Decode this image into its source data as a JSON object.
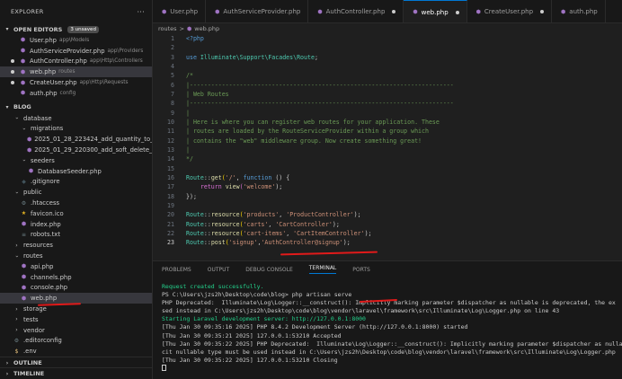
{
  "explorer": {
    "title": "EXPLORER",
    "more": "···",
    "open_editors": {
      "label": "OPEN EDITORS",
      "badge": "3 unsaved",
      "items": [
        {
          "name": "User.php",
          "path": "app\\Models",
          "state": "none"
        },
        {
          "name": "AuthServiceProvider.php",
          "path": "app\\Providers",
          "state": "none"
        },
        {
          "name": "AuthController.php",
          "path": "app\\Http\\Controllers",
          "state": "dot"
        },
        {
          "name": "web.php",
          "path": "routes",
          "state": "dot"
        },
        {
          "name": "CreateUser.php",
          "path": "app\\Http\\Requests",
          "state": "dot"
        },
        {
          "name": "auth.php",
          "path": "config",
          "state": "none"
        }
      ]
    },
    "project": {
      "label": "BLOG",
      "tree": [
        {
          "label": "database",
          "depth": 1,
          "kind": "folder-open"
        },
        {
          "label": "migrations",
          "depth": 2,
          "kind": "folder-open"
        },
        {
          "label": "2025_01_28_223424_add_quantity_to_cart...",
          "depth": 3,
          "kind": "php"
        },
        {
          "label": "2025_01_29_220300_add_soft_delete_to_c...",
          "depth": 3,
          "kind": "php"
        },
        {
          "label": "seeders",
          "depth": 2,
          "kind": "folder-open"
        },
        {
          "label": "DatabaseSeeder.php",
          "depth": 3,
          "kind": "php"
        },
        {
          "label": ".gitignore",
          "depth": 2,
          "kind": "git"
        },
        {
          "label": "public",
          "depth": 1,
          "kind": "folder-open"
        },
        {
          "label": ".htaccess",
          "depth": 2,
          "kind": "gear"
        },
        {
          "label": "favicon.ico",
          "depth": 2,
          "kind": "star"
        },
        {
          "label": "index.php",
          "depth": 2,
          "kind": "php"
        },
        {
          "label": "robots.txt",
          "depth": 2,
          "kind": "txt"
        },
        {
          "label": "resources",
          "depth": 1,
          "kind": "folder"
        },
        {
          "label": "routes",
          "depth": 1,
          "kind": "folder-open"
        },
        {
          "label": "api.php",
          "depth": 2,
          "kind": "php"
        },
        {
          "label": "channels.php",
          "depth": 2,
          "kind": "php"
        },
        {
          "label": "console.php",
          "depth": 2,
          "kind": "php"
        },
        {
          "label": "web.php",
          "depth": 2,
          "kind": "php",
          "selected": true
        },
        {
          "label": "storage",
          "depth": 1,
          "kind": "folder"
        },
        {
          "label": "tests",
          "depth": 1,
          "kind": "folder"
        },
        {
          "label": "vendor",
          "depth": 1,
          "kind": "folder"
        },
        {
          "label": ".editorconfig",
          "depth": 1,
          "kind": "gear"
        },
        {
          "label": ".env",
          "depth": 1,
          "kind": "dollar"
        }
      ]
    },
    "outline": "OUTLINE",
    "timeline": "TIMELINE"
  },
  "tabs": [
    {
      "label": "User.php",
      "active": false,
      "dirty": false
    },
    {
      "label": "AuthServiceProvider.php",
      "active": false,
      "dirty": false
    },
    {
      "label": "AuthController.php",
      "active": false,
      "dirty": true
    },
    {
      "label": "web.php",
      "active": true,
      "dirty": true
    },
    {
      "label": "CreateUser.php",
      "active": false,
      "dirty": true
    },
    {
      "label": "auth.php",
      "active": false,
      "dirty": false
    }
  ],
  "breadcrumb": [
    "routes",
    ">",
    "web.php"
  ],
  "editor": {
    "lines": [
      "<?php",
      "",
      "use Illuminate\\Support\\Facades\\Route;",
      "",
      "/*",
      "|--------------------------------------------------------------------------",
      "| Web Routes",
      "|--------------------------------------------------------------------------",
      "|",
      "| Here is where you can register web routes for your application. These",
      "| routes are loaded by the RouteServiceProvider within a group which",
      "| contains the \"web\" middleware group. Now create something great!",
      "|",
      "*/",
      "",
      "Route::get('/', function () {",
      "    return view('welcome');",
      "});",
      "",
      "Route::resource('products', 'ProductController');",
      "Route::resource('carts', 'CartController');",
      "Route::resource('cart-items', 'CartItemController');",
      "Route::post('signup','AuthController@signup');"
    ],
    "current_line": 23
  },
  "panel": {
    "tabs": [
      "PROBLEMS",
      "OUTPUT",
      "DEBUG CONSOLE",
      "TERMINAL",
      "PORTS"
    ],
    "active_tab": "TERMINAL",
    "terminal": [
      {
        "text": "Request created successfully.",
        "color": "green"
      },
      {
        "text": "PS C:\\Users\\jzs2h\\Desktop\\code\\blog> php artisan serve",
        "color": "default"
      },
      {
        "text": "PHP Deprecated:  Illuminate\\Log\\Logger::__construct(): Implicitly marking parameter $dispatcher as nullable is deprecated, the ex",
        "color": "default"
      },
      {
        "text": "sed instead in C:\\Users\\jzs2h\\Desktop\\code\\blog\\vendor\\laravel\\framework\\src\\Illuminate\\Log\\Logger.php on line 43",
        "color": "default"
      },
      {
        "text": "Starting Laravel development server: http://127.0.0.1:8000",
        "color": "green"
      },
      {
        "text": "[Thu Jan 30 09:35:16 2025] PHP 8.4.2 Development Server (http://127.0.0.1:8000) started",
        "color": "default"
      },
      {
        "text": "[Thu Jan 30 09:35:21 2025] 127.0.0.1:53210 Accepted",
        "color": "default"
      },
      {
        "text": "[Thu Jan 30 09:35:22 2025] PHP Deprecated:  Illuminate\\Log\\Logger::__construct(): Implicitly marking parameter $dispatcher as nullable is",
        "color": "default"
      },
      {
        "text": "cit nullable type must be used instead in C:\\Users\\jzs2h\\Desktop\\code\\blog\\vendor\\laravel\\framework\\src\\Illuminate\\Log\\Logger.php",
        "color": "default"
      },
      {
        "text": "[Thu Jan 30 09:35:22 2025] 127.0.0.1:53210 Closing",
        "color": "default"
      }
    ]
  },
  "colors": {
    "accent": "#0078d4",
    "annotation_red": "#e01a1a",
    "terminal_green": "#23d18b"
  }
}
